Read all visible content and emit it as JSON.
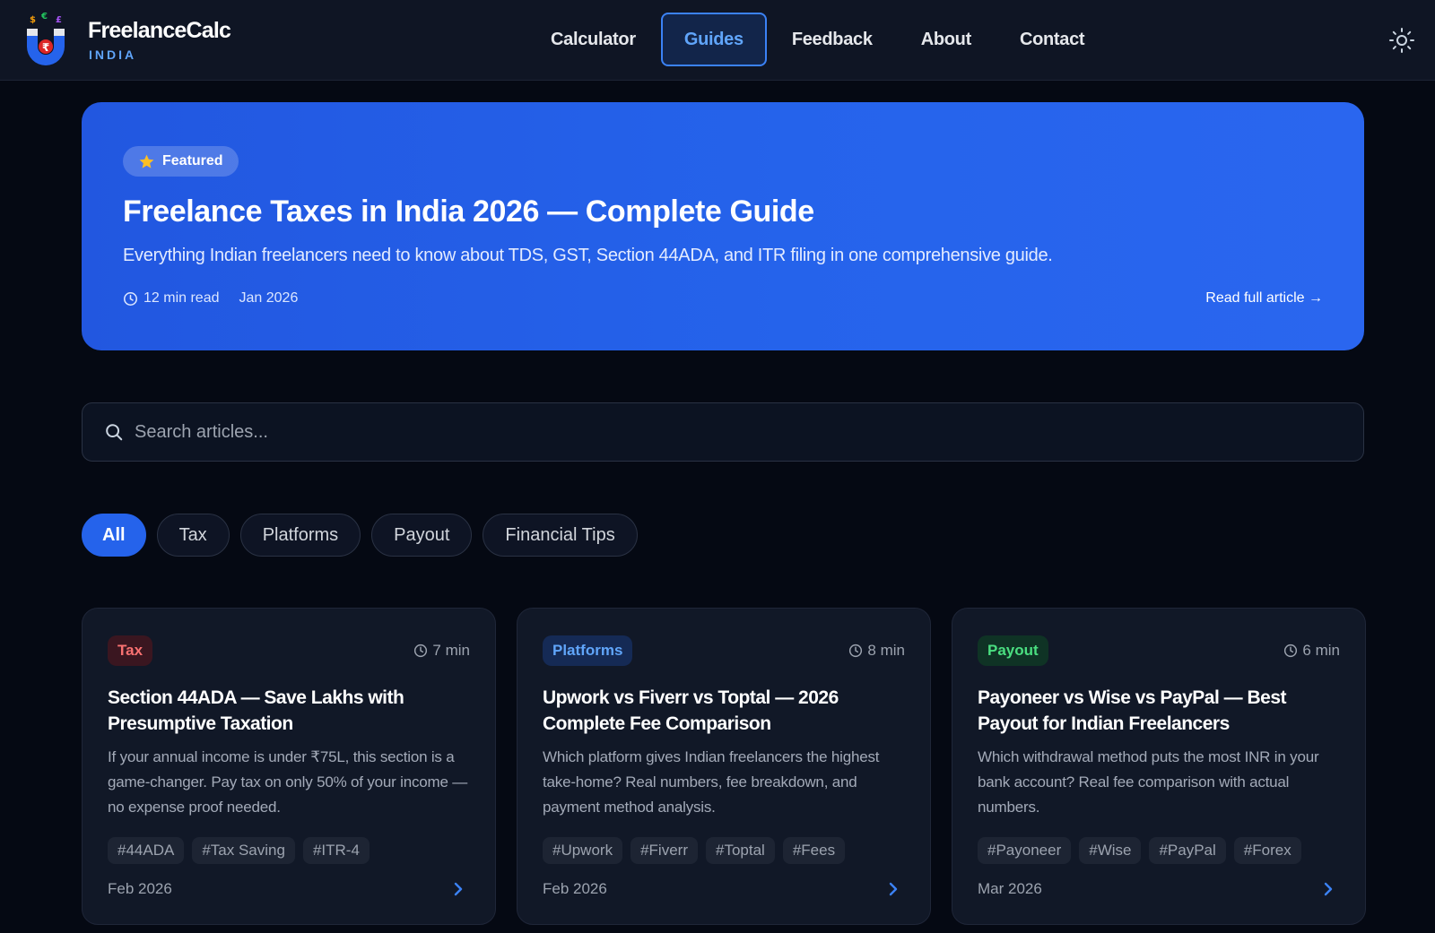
{
  "header": {
    "brand_name": "FreelanceCalc",
    "brand_sub": "INDIA",
    "nav": [
      {
        "label": "Calculator",
        "active": false
      },
      {
        "label": "Guides",
        "active": true
      },
      {
        "label": "Feedback",
        "active": false
      },
      {
        "label": "About",
        "active": false
      },
      {
        "label": "Contact",
        "active": false
      }
    ],
    "theme_icon": "sun-icon"
  },
  "hero": {
    "badge": "Featured",
    "badge_icon": "star-icon",
    "title": "Freelance Taxes in India 2026 — Complete Guide",
    "description": "Everything Indian freelancers need to know about TDS, GST, Section 44ADA, and ITR filing in one comprehensive guide.",
    "read_time": "12 min read",
    "date": "Jan 2026",
    "link": "Read full article →"
  },
  "search": {
    "placeholder": "Search articles..."
  },
  "filters": [
    {
      "label": "All",
      "active": true
    },
    {
      "label": "Tax",
      "active": false
    },
    {
      "label": "Platforms",
      "active": false
    },
    {
      "label": "Payout",
      "active": false
    },
    {
      "label": "Financial Tips",
      "active": false
    }
  ],
  "cards": [
    {
      "category": "Tax",
      "read_time": "7 min",
      "title": "Section 44ADA — Save Lakhs with Presumptive Taxation",
      "description": "If your annual income is under ₹75L, this section is a game-changer. Pay tax on only 50% of your income — no expense proof needed.",
      "tags": [
        "#44ADA",
        "#Tax Saving",
        "#ITR-4"
      ],
      "date": "Feb 2026"
    },
    {
      "category": "Platforms",
      "read_time": "8 min",
      "title": "Upwork vs Fiverr vs Toptal — 2026 Complete Fee Comparison",
      "description": "Which platform gives Indian freelancers the highest take-home? Real numbers, fee breakdown, and payment method analysis.",
      "tags": [
        "#Upwork",
        "#Fiverr",
        "#Toptal",
        "#Fees"
      ],
      "date": "Feb 2026"
    },
    {
      "category": "Payout",
      "read_time": "6 min",
      "title": "Payoneer vs Wise vs PayPal — Best Payout for Indian Freelancers",
      "description": "Which withdrawal method puts the most INR in your bank account? Real fee comparison with actual numbers.",
      "tags": [
        "#Payoneer",
        "#Wise",
        "#PayPal",
        "#Forex"
      ],
      "date": "Mar 2026"
    }
  ],
  "colors": {
    "accent": "#2563eb",
    "background": "#050913",
    "header_bg": "#0f1524",
    "card_bg": "#111827",
    "tax": "#f87171",
    "platforms": "#60a5fa",
    "payout": "#4ade80"
  }
}
